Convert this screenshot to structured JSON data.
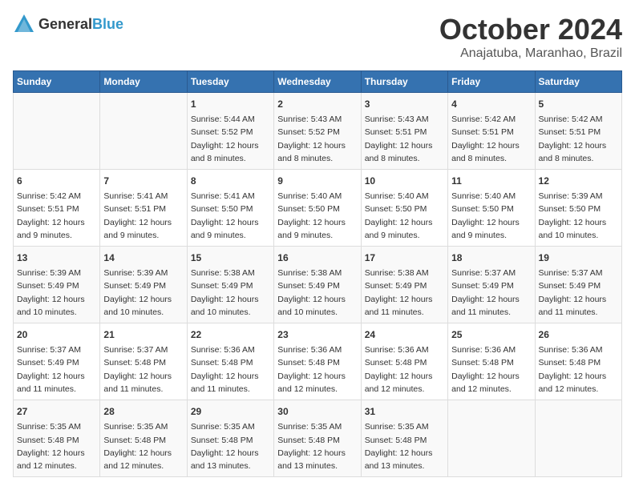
{
  "logo": {
    "general": "General",
    "blue": "Blue"
  },
  "title": "October 2024",
  "subtitle": "Anajatuba, Maranhao, Brazil",
  "days": [
    "Sunday",
    "Monday",
    "Tuesday",
    "Wednesday",
    "Thursday",
    "Friday",
    "Saturday"
  ],
  "weeks": [
    [
      {
        "day": "",
        "content": ""
      },
      {
        "day": "",
        "content": ""
      },
      {
        "day": "1",
        "content": "Sunrise: 5:44 AM\nSunset: 5:52 PM\nDaylight: 12 hours\nand 8 minutes."
      },
      {
        "day": "2",
        "content": "Sunrise: 5:43 AM\nSunset: 5:52 PM\nDaylight: 12 hours\nand 8 minutes."
      },
      {
        "day": "3",
        "content": "Sunrise: 5:43 AM\nSunset: 5:51 PM\nDaylight: 12 hours\nand 8 minutes."
      },
      {
        "day": "4",
        "content": "Sunrise: 5:42 AM\nSunset: 5:51 PM\nDaylight: 12 hours\nand 8 minutes."
      },
      {
        "day": "5",
        "content": "Sunrise: 5:42 AM\nSunset: 5:51 PM\nDaylight: 12 hours\nand 8 minutes."
      }
    ],
    [
      {
        "day": "6",
        "content": "Sunrise: 5:42 AM\nSunset: 5:51 PM\nDaylight: 12 hours\nand 9 minutes."
      },
      {
        "day": "7",
        "content": "Sunrise: 5:41 AM\nSunset: 5:51 PM\nDaylight: 12 hours\nand 9 minutes."
      },
      {
        "day": "8",
        "content": "Sunrise: 5:41 AM\nSunset: 5:50 PM\nDaylight: 12 hours\nand 9 minutes."
      },
      {
        "day": "9",
        "content": "Sunrise: 5:40 AM\nSunset: 5:50 PM\nDaylight: 12 hours\nand 9 minutes."
      },
      {
        "day": "10",
        "content": "Sunrise: 5:40 AM\nSunset: 5:50 PM\nDaylight: 12 hours\nand 9 minutes."
      },
      {
        "day": "11",
        "content": "Sunrise: 5:40 AM\nSunset: 5:50 PM\nDaylight: 12 hours\nand 9 minutes."
      },
      {
        "day": "12",
        "content": "Sunrise: 5:39 AM\nSunset: 5:50 PM\nDaylight: 12 hours\nand 10 minutes."
      }
    ],
    [
      {
        "day": "13",
        "content": "Sunrise: 5:39 AM\nSunset: 5:49 PM\nDaylight: 12 hours\nand 10 minutes."
      },
      {
        "day": "14",
        "content": "Sunrise: 5:39 AM\nSunset: 5:49 PM\nDaylight: 12 hours\nand 10 minutes."
      },
      {
        "day": "15",
        "content": "Sunrise: 5:38 AM\nSunset: 5:49 PM\nDaylight: 12 hours\nand 10 minutes."
      },
      {
        "day": "16",
        "content": "Sunrise: 5:38 AM\nSunset: 5:49 PM\nDaylight: 12 hours\nand 10 minutes."
      },
      {
        "day": "17",
        "content": "Sunrise: 5:38 AM\nSunset: 5:49 PM\nDaylight: 12 hours\nand 11 minutes."
      },
      {
        "day": "18",
        "content": "Sunrise: 5:37 AM\nSunset: 5:49 PM\nDaylight: 12 hours\nand 11 minutes."
      },
      {
        "day": "19",
        "content": "Sunrise: 5:37 AM\nSunset: 5:49 PM\nDaylight: 12 hours\nand 11 minutes."
      }
    ],
    [
      {
        "day": "20",
        "content": "Sunrise: 5:37 AM\nSunset: 5:49 PM\nDaylight: 12 hours\nand 11 minutes."
      },
      {
        "day": "21",
        "content": "Sunrise: 5:37 AM\nSunset: 5:48 PM\nDaylight: 12 hours\nand 11 minutes."
      },
      {
        "day": "22",
        "content": "Sunrise: 5:36 AM\nSunset: 5:48 PM\nDaylight: 12 hours\nand 11 minutes."
      },
      {
        "day": "23",
        "content": "Sunrise: 5:36 AM\nSunset: 5:48 PM\nDaylight: 12 hours\nand 12 minutes."
      },
      {
        "day": "24",
        "content": "Sunrise: 5:36 AM\nSunset: 5:48 PM\nDaylight: 12 hours\nand 12 minutes."
      },
      {
        "day": "25",
        "content": "Sunrise: 5:36 AM\nSunset: 5:48 PM\nDaylight: 12 hours\nand 12 minutes."
      },
      {
        "day": "26",
        "content": "Sunrise: 5:36 AM\nSunset: 5:48 PM\nDaylight: 12 hours\nand 12 minutes."
      }
    ],
    [
      {
        "day": "27",
        "content": "Sunrise: 5:35 AM\nSunset: 5:48 PM\nDaylight: 12 hours\nand 12 minutes."
      },
      {
        "day": "28",
        "content": "Sunrise: 5:35 AM\nSunset: 5:48 PM\nDaylight: 12 hours\nand 12 minutes."
      },
      {
        "day": "29",
        "content": "Sunrise: 5:35 AM\nSunset: 5:48 PM\nDaylight: 12 hours\nand 13 minutes."
      },
      {
        "day": "30",
        "content": "Sunrise: 5:35 AM\nSunset: 5:48 PM\nDaylight: 12 hours\nand 13 minutes."
      },
      {
        "day": "31",
        "content": "Sunrise: 5:35 AM\nSunset: 5:48 PM\nDaylight: 12 hours\nand 13 minutes."
      },
      {
        "day": "",
        "content": ""
      },
      {
        "day": "",
        "content": ""
      }
    ]
  ]
}
